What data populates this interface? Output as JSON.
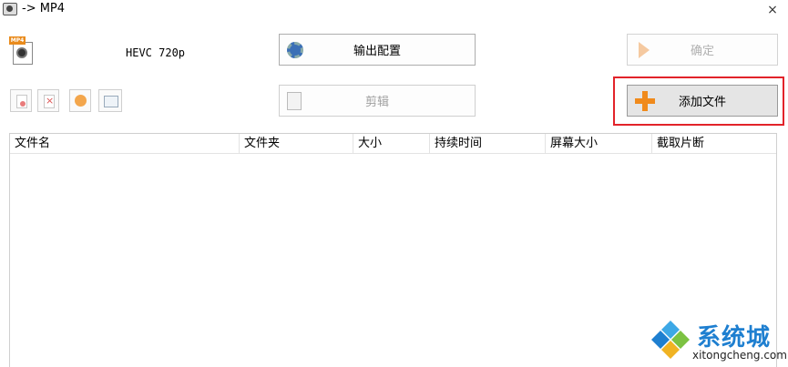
{
  "window": {
    "title": "-> MP4",
    "close_glyph": "×"
  },
  "format": {
    "icon": "mp4-file-icon",
    "icon_tag": "MP4",
    "label": "HEVC 720p"
  },
  "buttons": {
    "output_config": "输出配置",
    "ok": "确定",
    "edit": "剪辑",
    "add_file": "添加文件"
  },
  "toolbar": {
    "icons": [
      "add-file-small-icon",
      "remove-file-icon",
      "play-icon",
      "window-icon"
    ]
  },
  "file_list": {
    "columns": [
      "文件名",
      "文件夹",
      "大小",
      "持续时间",
      "屏幕大小",
      "截取片断"
    ],
    "rows": []
  },
  "watermark": {
    "name": "系统城",
    "url": "xitongcheng.com"
  },
  "colors": {
    "highlight": "#e2232a",
    "accent_orange": "#f08a1c",
    "watermark_blue": "#1e7fd0"
  }
}
